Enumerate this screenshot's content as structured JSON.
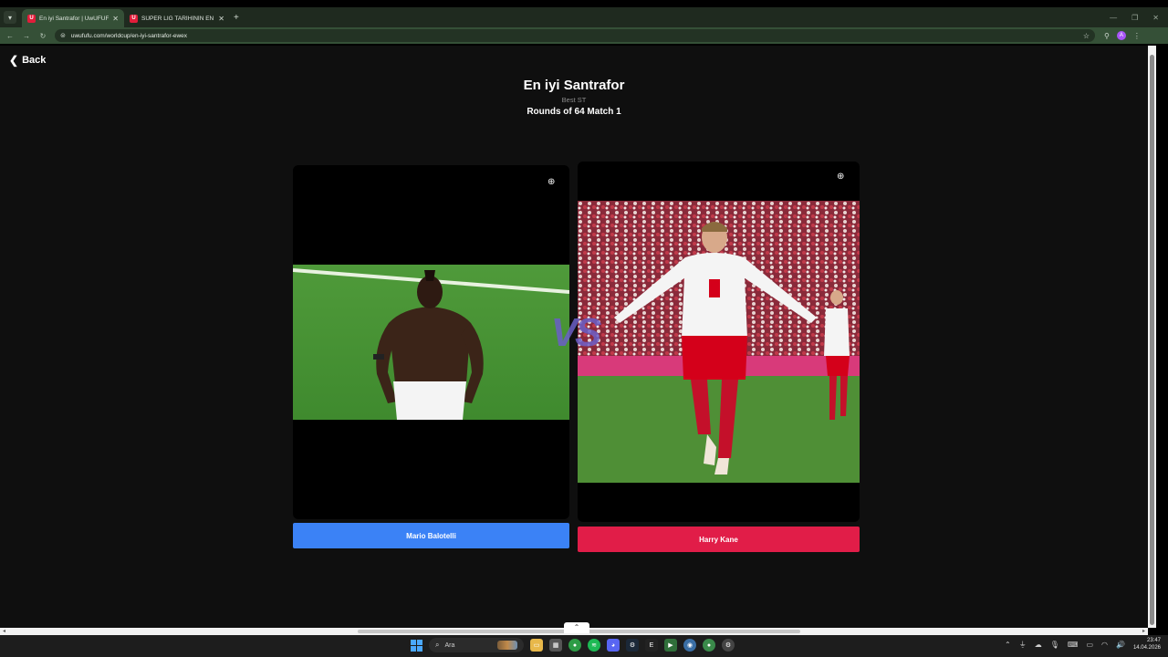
{
  "browser": {
    "tabs": [
      {
        "title": "En iyi Santrafor | UwUFUFU",
        "active": true
      },
      {
        "title": "SÜPER LIG TARİHİNİN EN İYİ FU",
        "active": false
      }
    ],
    "url": "uwufufu.com/worldcup/en-iyi-santrafor-ewex",
    "profile_initial": "A"
  },
  "page": {
    "back_label": "Back",
    "title": "En iyi Santrafor",
    "subtitle": "Best ST",
    "round": "Rounds of 64 Match 1",
    "vs_text": "VS",
    "left": {
      "name": "Mario Balotelli",
      "button_color": "#3b82f6"
    },
    "right": {
      "name": "Harry Kane",
      "button_color": "#e11d48"
    }
  },
  "taskbar": {
    "search_placeholder": "Ara",
    "time": "23:47",
    "date": "14.04.2026"
  }
}
